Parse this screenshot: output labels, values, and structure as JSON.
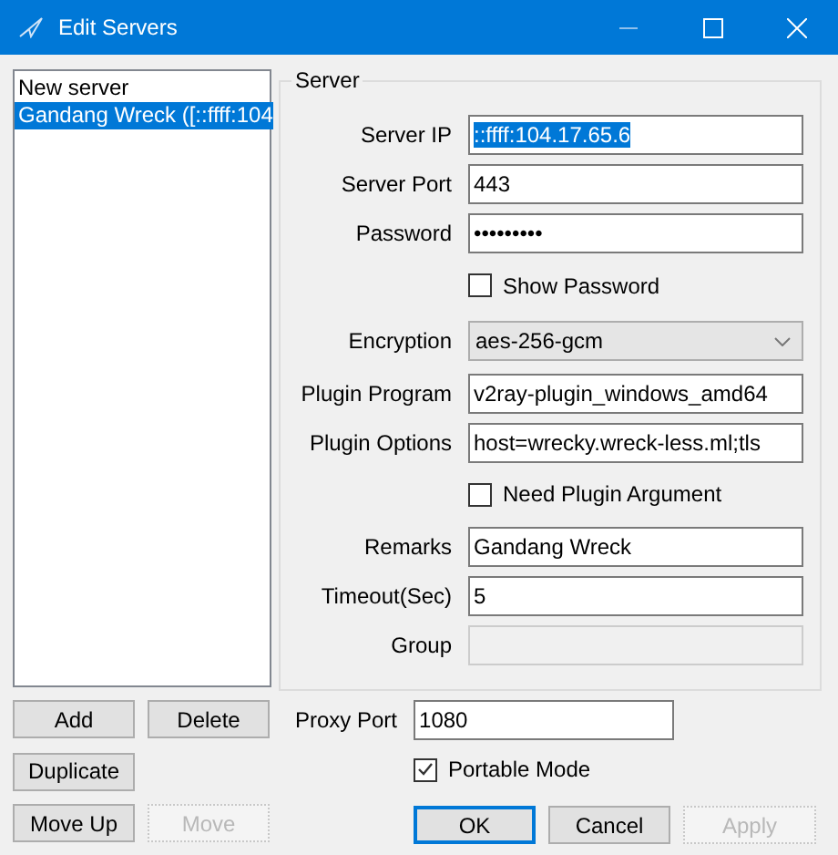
{
  "window": {
    "title": "Edit Servers"
  },
  "servers": [
    {
      "label": "New server",
      "selected": false
    },
    {
      "label": "Gandang Wreck ([::ffff:104",
      "selected": true
    }
  ],
  "group": {
    "title": "Server"
  },
  "fields": [
    {
      "kind": "text",
      "label": "Server IP",
      "value": "::ffff:104.17.65.6",
      "text_selected": true,
      "disabled": false
    },
    {
      "kind": "text",
      "label": "Server Port",
      "value": "443",
      "text_selected": false,
      "disabled": false
    },
    {
      "kind": "password",
      "label": "Password",
      "value": "•••••••••",
      "text_selected": false,
      "disabled": false
    },
    {
      "kind": "checkbox",
      "label": "Show Password",
      "checked": false
    },
    {
      "kind": "select",
      "label": "Encryption",
      "value": "aes-256-gcm"
    },
    {
      "kind": "text",
      "label": "Plugin Program",
      "value": "v2ray-plugin_windows_amd64",
      "text_selected": false,
      "disabled": false
    },
    {
      "kind": "text",
      "label": "Plugin Options",
      "value": "host=wrecky.wreck-less.ml;tls",
      "text_selected": false,
      "disabled": false
    },
    {
      "kind": "checkbox",
      "label": "Need Plugin Argument",
      "checked": false
    },
    {
      "kind": "text",
      "label": "Remarks",
      "value": "Gandang Wreck",
      "text_selected": false,
      "disabled": false
    },
    {
      "kind": "text",
      "label": "Timeout(Sec)",
      "value": "5",
      "text_selected": false,
      "disabled": false
    },
    {
      "kind": "text",
      "label": "Group",
      "disabled": true
    }
  ],
  "list_buttons": [
    {
      "label": "Add",
      "disabled": false
    },
    {
      "label": "Delete",
      "disabled": false
    },
    {
      "label": "Duplicate",
      "disabled": false
    },
    {
      "label": "Move Up",
      "disabled": false
    },
    {
      "label": "Move",
      "disabled": true
    }
  ],
  "proxy_port": {
    "label": "Proxy Port",
    "value": "1080"
  },
  "portable_mode": {
    "label": "Portable Mode",
    "checked": true
  },
  "dialog_buttons": [
    {
      "label": "OK",
      "disabled": false,
      "default": true
    },
    {
      "label": "Cancel",
      "disabled": false,
      "default": false
    },
    {
      "label": "Apply",
      "disabled": true,
      "default": false
    }
  ]
}
